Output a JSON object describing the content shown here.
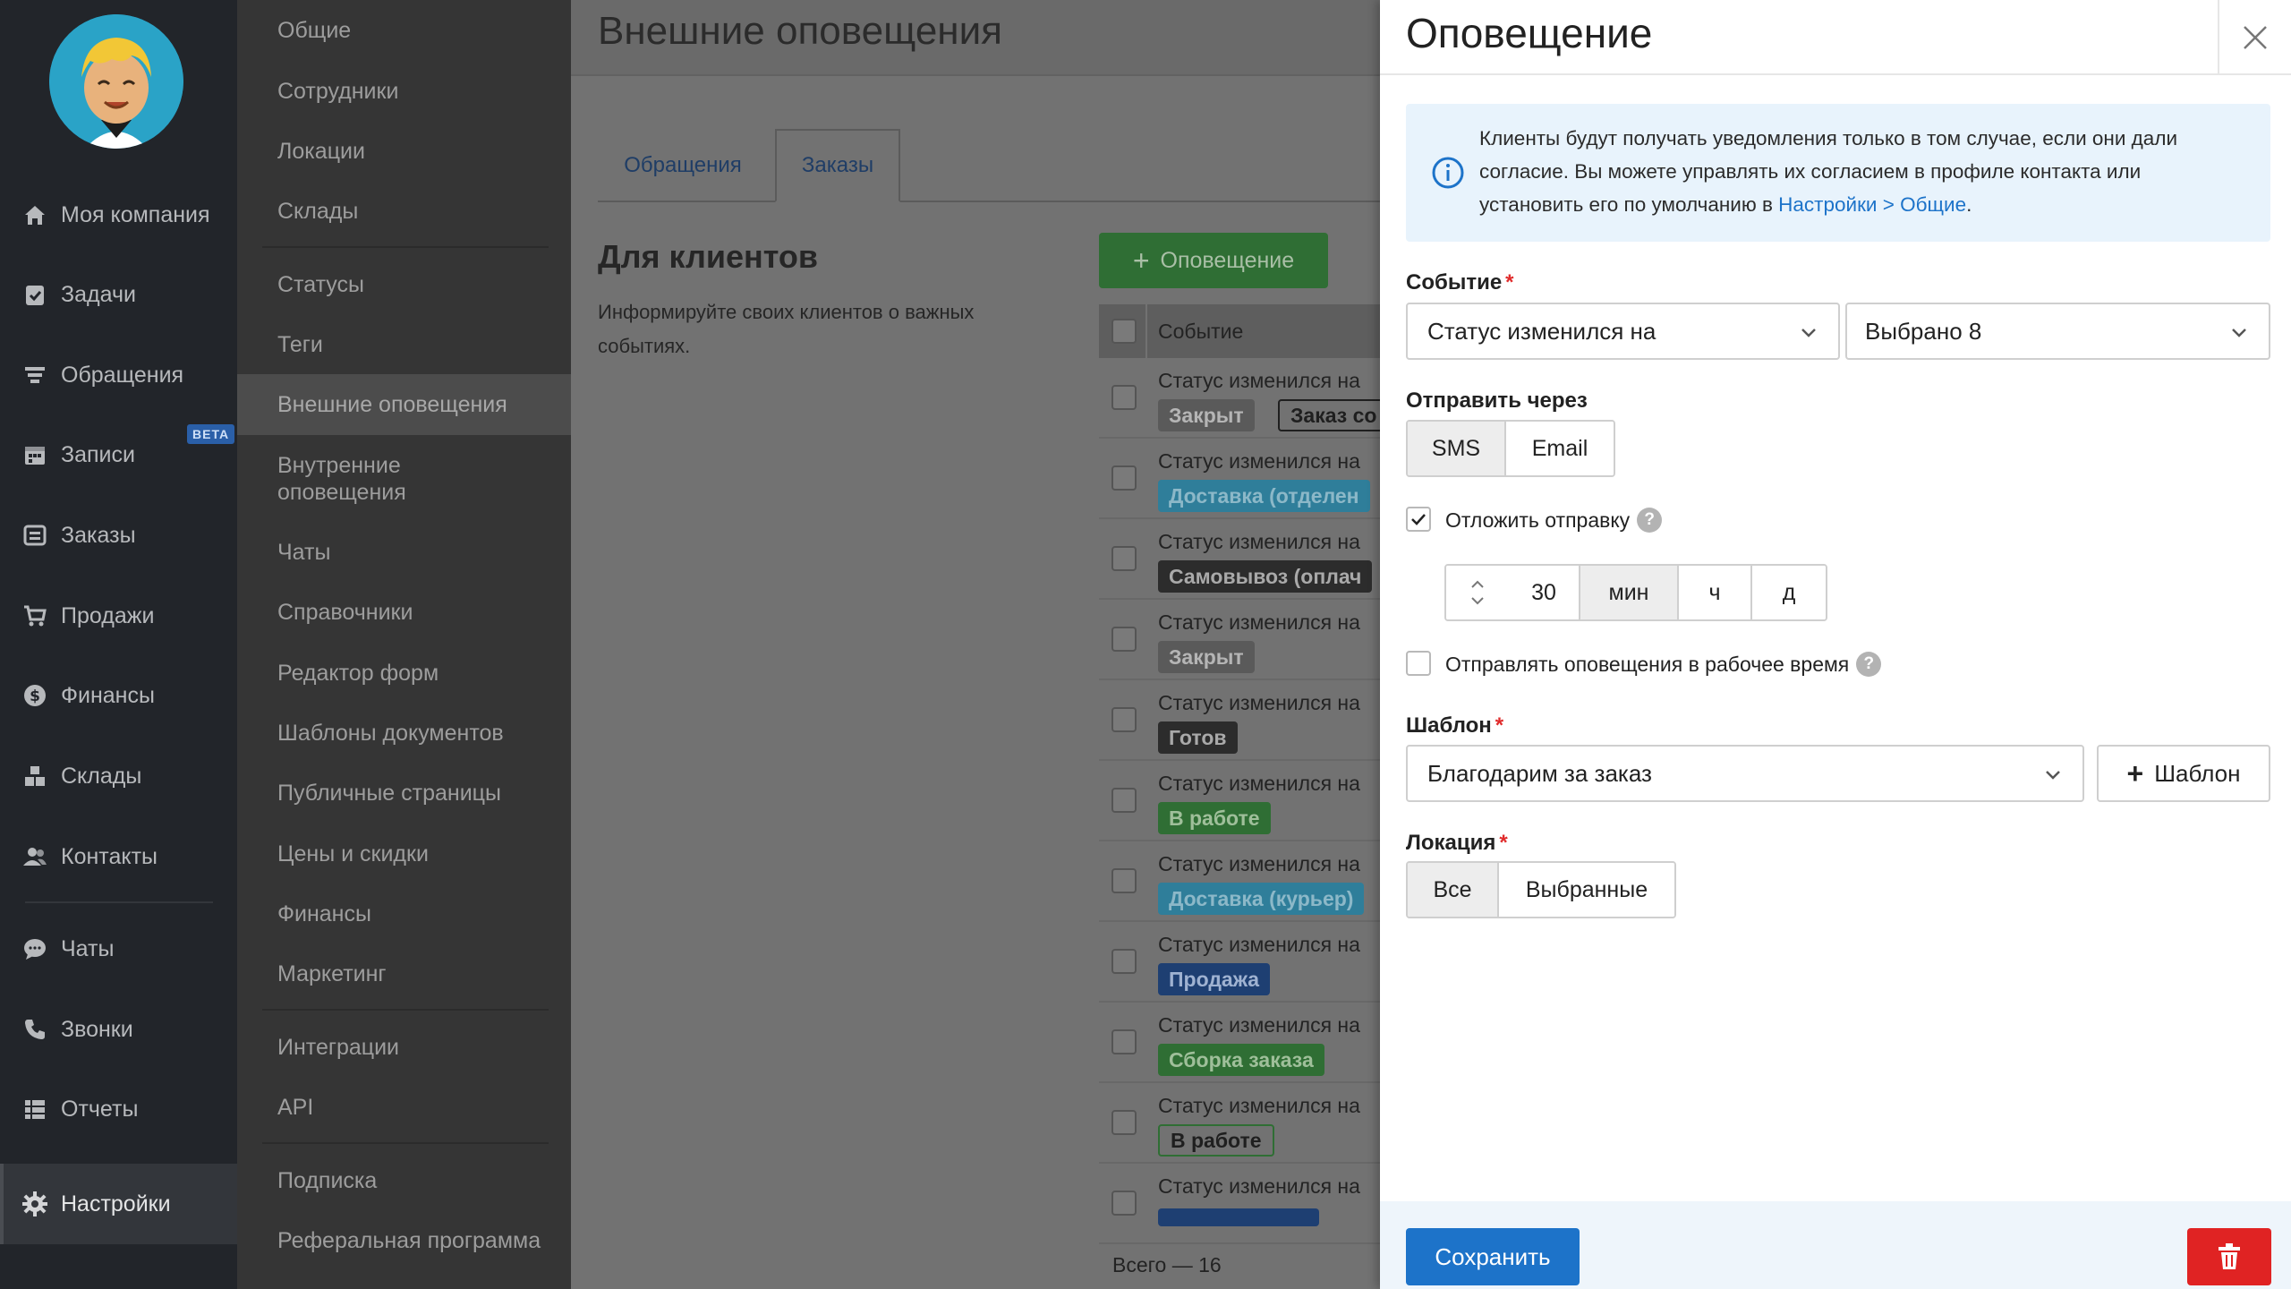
{
  "nav": {
    "items": [
      {
        "label": "Моя компания",
        "icon": "home-icon"
      },
      {
        "label": "Задачи",
        "icon": "clipboard-check-icon"
      },
      {
        "label": "Обращения",
        "icon": "funnel-icon"
      },
      {
        "label": "Записи",
        "icon": "calendar-icon"
      },
      {
        "label": "Заказы",
        "icon": "orders-icon"
      },
      {
        "label": "Продажи",
        "icon": "cart-icon"
      },
      {
        "label": "Финансы",
        "icon": "dollar-icon"
      },
      {
        "label": "Склады",
        "icon": "boxes-icon"
      },
      {
        "label": "Контакты",
        "icon": "users-icon"
      },
      {
        "label": "Чаты",
        "icon": "chat-icon"
      },
      {
        "label": "Звонки",
        "icon": "phone-icon"
      },
      {
        "label": "Отчеты",
        "icon": "report-icon"
      },
      {
        "label": "Настройки",
        "icon": "gear-icon"
      }
    ],
    "beta_label": "BETA"
  },
  "subnav": {
    "items": [
      "Общие",
      "Сотрудники",
      "Локации",
      "Склады",
      "Статусы",
      "Теги",
      "Внешние оповещения",
      "Внутренние оповещения",
      "Чаты",
      "Справочники",
      "Редактор форм",
      "Шаблоны документов",
      "Публичные страницы",
      "Цены и скидки",
      "Финансы",
      "Маркетинг",
      "Интеграции",
      "API",
      "Подписка",
      "Реферальная программа"
    ]
  },
  "main": {
    "title": "Внешние оповещения",
    "tabs": [
      "Обращения",
      "Заказы"
    ],
    "section_title": "Для клиентов",
    "section_desc": "Информируйте своих клиентов о важных событиях.",
    "add_button": "Оповещение",
    "column_event": "Событие",
    "rows": [
      {
        "text": "Статус изменился на",
        "badges": [
          {
            "label": "Закрыт",
            "style": "gray"
          },
          {
            "label": "Заказ со",
            "style": "outline"
          }
        ]
      },
      {
        "text": "Статус изменился на",
        "badges": [
          {
            "label": "Доставка (отделен",
            "style": "cyan"
          }
        ]
      },
      {
        "text": "Статус изменился на",
        "badges": [
          {
            "label": "Самовывоз (оплач",
            "style": "dark"
          }
        ]
      },
      {
        "text": "Статус изменился на",
        "badges": [
          {
            "label": "Закрыт",
            "style": "gray"
          }
        ]
      },
      {
        "text": "Статус изменился на",
        "badges": [
          {
            "label": "Готов",
            "style": "dark"
          }
        ]
      },
      {
        "text": "Статус изменился на",
        "badges": [
          {
            "label": "В работе",
            "style": "green"
          }
        ]
      },
      {
        "text": "Статус изменился на",
        "badges": [
          {
            "label": "Доставка (курьер)",
            "style": "cyan"
          }
        ]
      },
      {
        "text": "Статус изменился на",
        "badges": [
          {
            "label": "Продажа",
            "style": "blue"
          }
        ]
      },
      {
        "text": "Статус изменился на",
        "badges": [
          {
            "label": "Сборка заказа",
            "style": "green"
          }
        ]
      },
      {
        "text": "Статус изменился на",
        "badges": [
          {
            "label": "В работе",
            "style": "green-outline"
          }
        ]
      },
      {
        "text": "Статус изменился на",
        "badges": []
      }
    ],
    "total": "Всего — 16"
  },
  "drawer": {
    "title": "Оповещение",
    "info_text": "Клиенты будут получать уведомления только в том случае, если они дали согласие. Вы можете управлять их согласием в профиле контакта или установить его по умолчанию в ",
    "info_link": "Настройки > Общие",
    "info_tail": ".",
    "event_label": "Событие",
    "event_value": "Статус изменился на",
    "event_selected": "Выбрано 8",
    "send_via_label": "Отправить через",
    "send_via": [
      "SMS",
      "Email"
    ],
    "delay_label": "Отложить отправку",
    "delay_checked": true,
    "delay_value": "30",
    "delay_units": [
      "мин",
      "ч",
      "д"
    ],
    "work_hours_label": "Отправлять оповещения в рабочее время",
    "work_hours_checked": false,
    "template_label": "Шаблон",
    "template_value": "Благодарим за заказ",
    "template_add": "Шаблон",
    "location_label": "Локация",
    "location_options": [
      "Все",
      "Выбранные"
    ],
    "save_label": "Сохранить"
  }
}
